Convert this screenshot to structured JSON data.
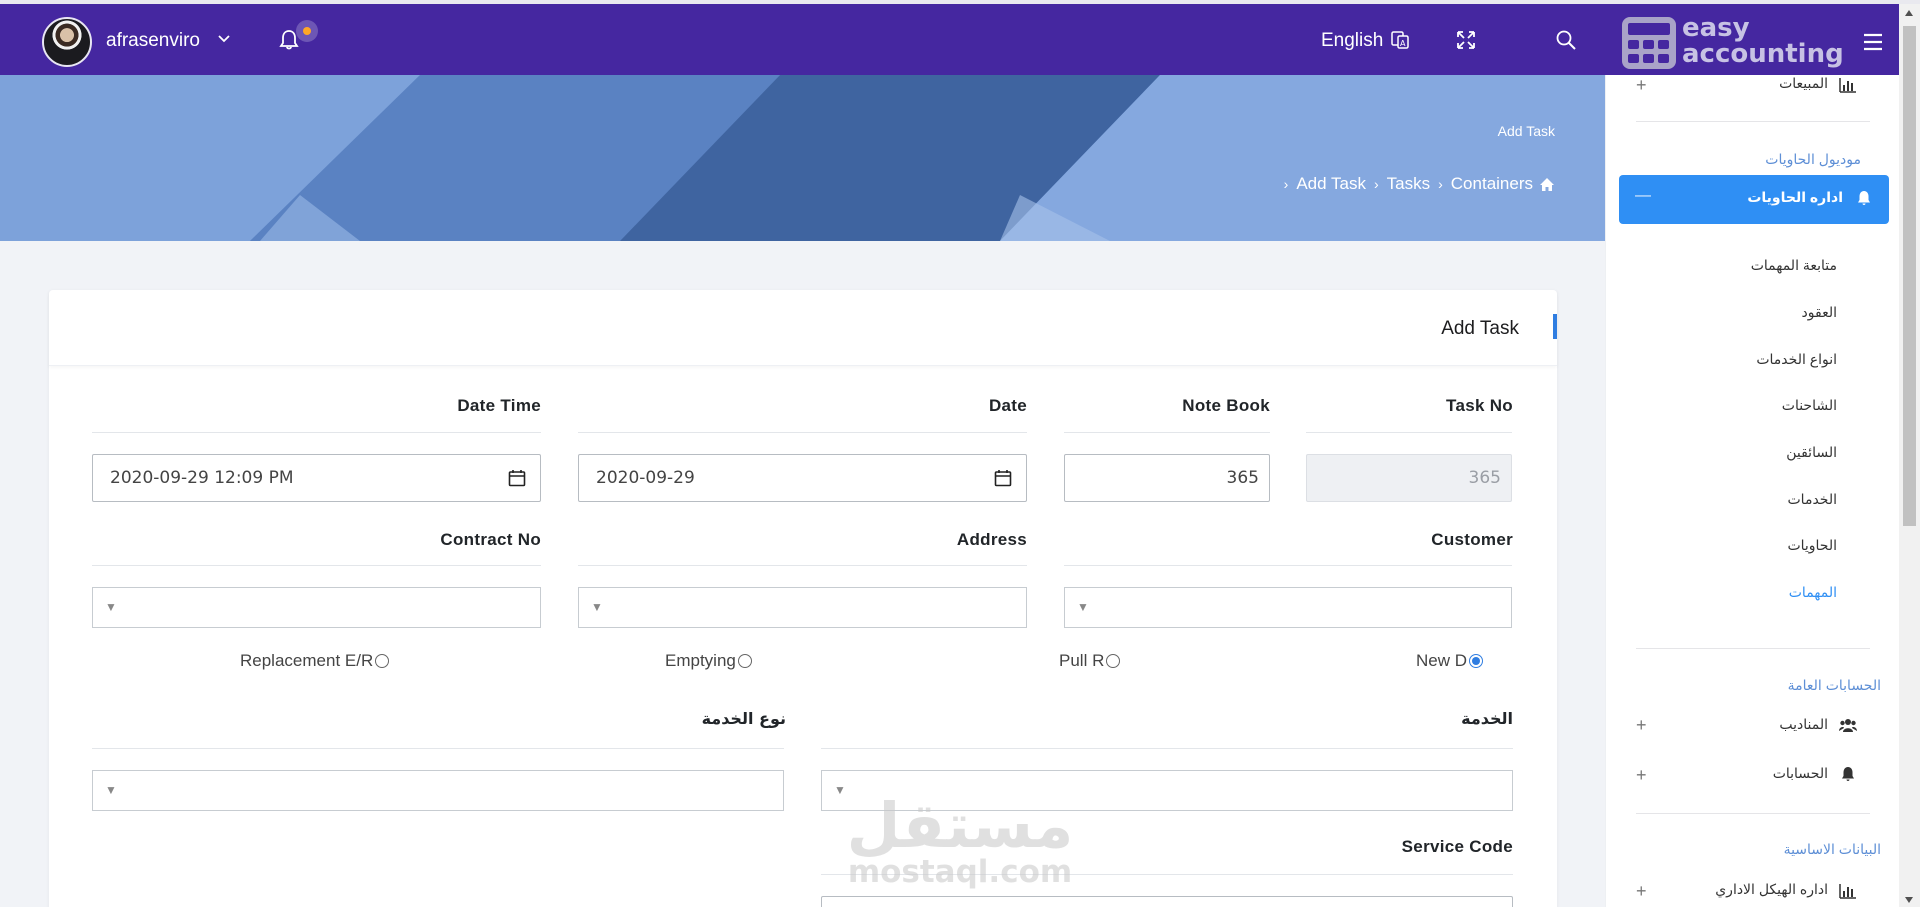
{
  "header": {
    "username": "afrasenviro",
    "language": "English",
    "logo_line1": "easy",
    "logo_line2": "accounting"
  },
  "banner": {
    "title": "Add Task",
    "breadcrumb": [
      "Containers",
      "Tasks",
      "Add Task"
    ]
  },
  "form": {
    "title": "Add Task",
    "labels": {
      "task_no": "Task No",
      "note_book": "Note Book",
      "date": "Date",
      "date_time": "Date Time",
      "customer": "Customer",
      "address": "Address",
      "contract_no": "Contract No",
      "service": "الخدمة",
      "service_type": "نوع الخدمة",
      "service_code": "Service Code"
    },
    "values": {
      "task_no": "365",
      "note_book": "365",
      "date": "2020-09-29",
      "date_time": "2020-09-29 12:09 PM"
    },
    "radios": [
      {
        "label": "New D",
        "checked": true
      },
      {
        "label": "Pull R",
        "checked": false
      },
      {
        "label": "Emptying",
        "checked": false
      },
      {
        "label": "Replacement E/R",
        "checked": false
      }
    ]
  },
  "watermark": {
    "arabic": "مستقل",
    "latin": "mostaql.com"
  },
  "sidebar": {
    "top_item": "المبيعات",
    "section_containers": "موديول الحاويات",
    "active_item": "اداره الحاويات",
    "sub_items": [
      "متابعة المهمات",
      "العقود",
      "انواع الخدمات",
      "الشاحنات",
      "السائقين",
      "الخدمات",
      "الحاويات",
      "المهمات"
    ],
    "active_sub": "المهمات",
    "section_accounts": "الحسابات العامة",
    "accounts_items": [
      "المناديب",
      "الحسابات"
    ],
    "section_basic": "البيانات الاساسية",
    "basic_item": "اداره الهيكل الاداري"
  },
  "colors": {
    "header": "#4527a0",
    "banner": "#6c93cf",
    "accent": "#2f8ff4",
    "section_heading": "#5e8fd6"
  }
}
